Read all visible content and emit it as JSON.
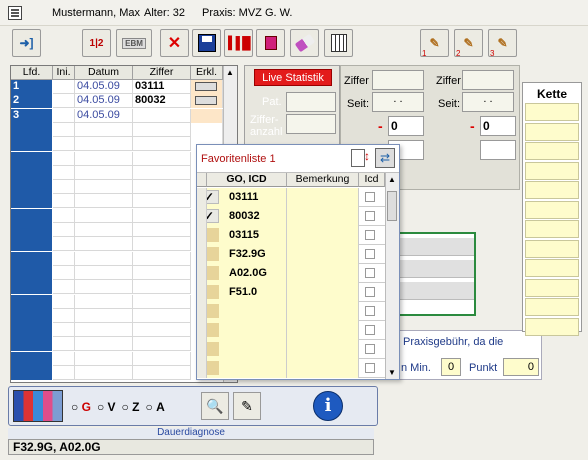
{
  "title": {
    "patient": "Mustermann, Max",
    "age_label": "Alter: 32",
    "praxis_label": "Praxis: MVZ G. W."
  },
  "toolbar": {
    "ebm_label": "EBM",
    "steps": [
      "1",
      "2",
      "3"
    ]
  },
  "grid": {
    "columns": [
      "Lfd.",
      "Ini.",
      "Datum",
      "Ziffer",
      "Erkl."
    ],
    "rows": [
      {
        "lfd": "1",
        "ini": "",
        "datum": "04.05.09",
        "ziffer": "03111",
        "erkl": true
      },
      {
        "lfd": "2",
        "ini": "",
        "datum": "04.05.09",
        "ziffer": "80032",
        "erkl": true
      },
      {
        "lfd": "3",
        "ini": "",
        "datum": "04.05.09",
        "ziffer": "",
        "erkl": false
      }
    ]
  },
  "stats": {
    "live_label": "Live Statistik",
    "pat_label": "Pat.",
    "ziffer_anzahl_label": "Ziffer-\nanzahl",
    "ziffer_label": "Ziffer",
    "seit_label": "Seit:",
    "seit_value": ". .",
    "minus": "-",
    "value": "0"
  },
  "kette": {
    "title": "Kette"
  },
  "fav": {
    "title": "Favoritenliste 1",
    "columns": [
      "GO, ICD",
      "Bemerkung",
      "Icd"
    ],
    "rows": [
      {
        "code": "03111",
        "icon": "check"
      },
      {
        "code": "80032",
        "icon": "check"
      },
      {
        "code": "03115",
        "icon": "pen"
      },
      {
        "code": "F32.9G",
        "icon": "pen"
      },
      {
        "code": "A02.0G",
        "icon": "pen"
      },
      {
        "code": "F51.0",
        "icon": "pen"
      },
      {
        "code": "",
        "icon": "pen"
      },
      {
        "code": "",
        "icon": "pen"
      },
      {
        "code": "",
        "icon": "pen"
      },
      {
        "code": "",
        "icon": "pen"
      }
    ]
  },
  "info": {
    "praxisgebuehr": "Praxisgebühr, da die",
    "min_label": "n Min.",
    "min_value": "0",
    "punkt_label": "Punkt",
    "punkt_value": "0"
  },
  "bottom": {
    "radio": [
      "G",
      "V",
      "Z",
      "A"
    ],
    "dauer_label": "Dauerdiagnose",
    "dauer_value": "F32.9G, A02.0G"
  }
}
